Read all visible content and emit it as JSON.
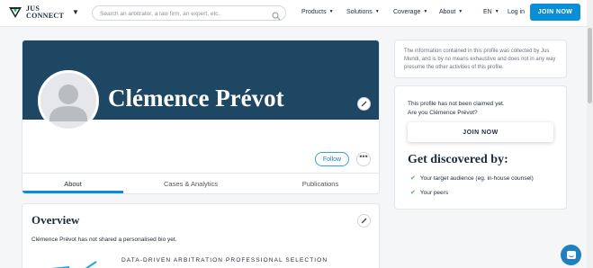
{
  "header": {
    "logo_line1": "JUS",
    "logo_line2": "CONNECT",
    "search_placeholder": "Search an arbitrator, a law firm, an expert, etc.",
    "nav": [
      {
        "label": "Products"
      },
      {
        "label": "Solutions"
      },
      {
        "label": "Coverage"
      },
      {
        "label": "About"
      }
    ],
    "language": "EN",
    "login": "Log in",
    "join": "JOIN NOW"
  },
  "profile": {
    "name": "Clémence Prévot",
    "follow": "Follow",
    "more": "•••",
    "tabs": [
      {
        "label": "About",
        "active": true
      },
      {
        "label": "Cases & Analytics",
        "active": false
      },
      {
        "label": "Publications",
        "active": false
      }
    ]
  },
  "overview": {
    "title": "Overview",
    "bio": "Clémence Prévot has not shared a personalised bio yet.",
    "promo": "DATA-DRIVEN ARBITRATION PROFESSIONAL SELECTION"
  },
  "sidebar": {
    "disclaimer": "The information contained in this profile was collected by Jus Mundi, and is by no means exhaustive and does not in any way presume the other activities of this profile.",
    "claim_line1": "This profile has not been claimed yet.",
    "claim_line2": "Are you Clémence Prévot?",
    "join": "JOIN NOW",
    "discover_title": "Get discovered by:",
    "benefits": [
      "Your target audience (eg. in-house counsel)",
      "Your peers"
    ]
  },
  "colors": {
    "accent": "#0b8ed8",
    "banner": "#1e4763",
    "check": "#39b54a"
  }
}
